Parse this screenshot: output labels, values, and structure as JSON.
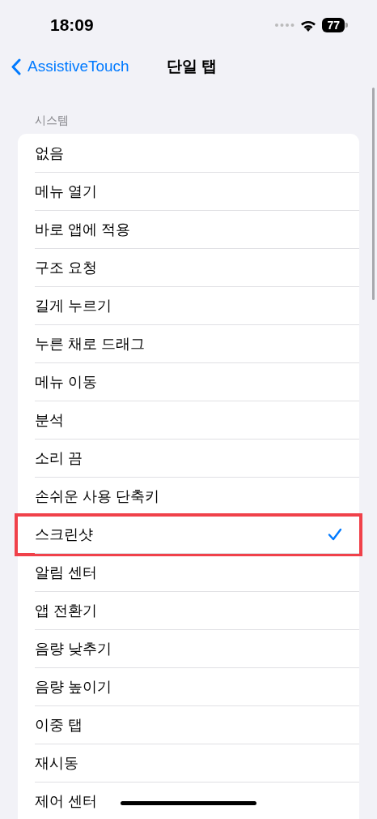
{
  "status_bar": {
    "time": "18:09",
    "battery": "77"
  },
  "nav": {
    "back": "AssistiveTouch",
    "title": "단일 탭"
  },
  "section": {
    "header": "시스템",
    "items": [
      {
        "label": "없음",
        "selected": false,
        "highlighted": false
      },
      {
        "label": "메뉴 열기",
        "selected": false,
        "highlighted": false
      },
      {
        "label": "바로 앱에 적용",
        "selected": false,
        "highlighted": false
      },
      {
        "label": "구조 요청",
        "selected": false,
        "highlighted": false
      },
      {
        "label": "길게 누르기",
        "selected": false,
        "highlighted": false
      },
      {
        "label": "누른 채로 드래그",
        "selected": false,
        "highlighted": false
      },
      {
        "label": "메뉴 이동",
        "selected": false,
        "highlighted": false
      },
      {
        "label": "분석",
        "selected": false,
        "highlighted": false
      },
      {
        "label": "소리 끔",
        "selected": false,
        "highlighted": false
      },
      {
        "label": "손쉬운 사용 단축키",
        "selected": false,
        "highlighted": false
      },
      {
        "label": "스크린샷",
        "selected": true,
        "highlighted": true
      },
      {
        "label": "알림 센터",
        "selected": false,
        "highlighted": false
      },
      {
        "label": "앱 전환기",
        "selected": false,
        "highlighted": false
      },
      {
        "label": "음량 낮추기",
        "selected": false,
        "highlighted": false
      },
      {
        "label": "음량 높이기",
        "selected": false,
        "highlighted": false
      },
      {
        "label": "이중 탭",
        "selected": false,
        "highlighted": false
      },
      {
        "label": "재시동",
        "selected": false,
        "highlighted": false
      },
      {
        "label": "제어 센터",
        "selected": false,
        "highlighted": false
      }
    ]
  }
}
